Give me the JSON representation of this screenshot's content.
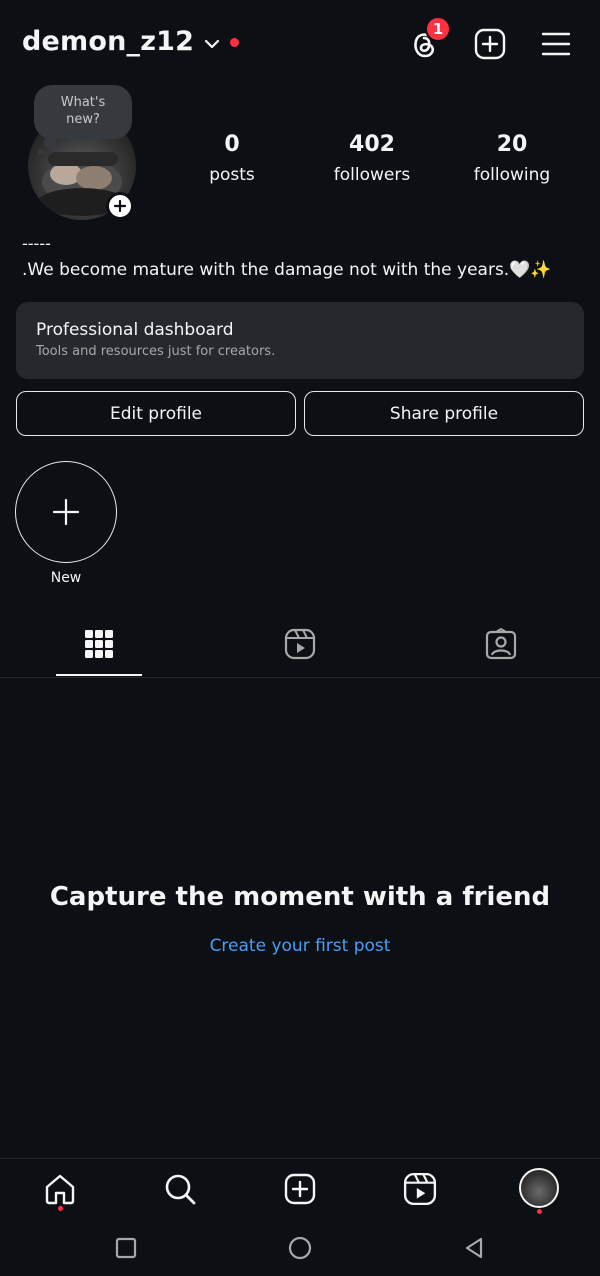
{
  "header": {
    "username": "demon_z12",
    "threads_badge": "1",
    "icons": [
      "chevron-down-icon",
      "threads-icon",
      "add-square-icon",
      "menu-icon"
    ]
  },
  "note": {
    "text_line1": "What's",
    "text_line2": "new?"
  },
  "stats": {
    "posts": {
      "value": "0",
      "label": "posts"
    },
    "followers": {
      "value": "402",
      "label": "followers"
    },
    "following": {
      "value": "20",
      "label": "following"
    }
  },
  "bio": {
    "line1": "-----",
    "line2": ".We become mature with the damage not with the years.🤍✨"
  },
  "dashboard": {
    "title": "Professional dashboard",
    "subtitle": "Tools and resources just for creators."
  },
  "buttons": {
    "edit": "Edit profile",
    "share": "Share profile"
  },
  "highlight": {
    "new_label": "New"
  },
  "tabs": [
    "grid-icon",
    "reels-icon",
    "tagged-icon"
  ],
  "empty_state": {
    "title": "Capture the moment with a friend",
    "link": "Create your first post"
  },
  "bottom_nav": [
    "home-icon",
    "search-icon",
    "add-icon",
    "reels-icon",
    "profile-avatar"
  ],
  "colors": {
    "background": "#0c1014",
    "accent_red": "#ff3040",
    "link_blue": "#4a9df8",
    "card": "#25292e"
  }
}
